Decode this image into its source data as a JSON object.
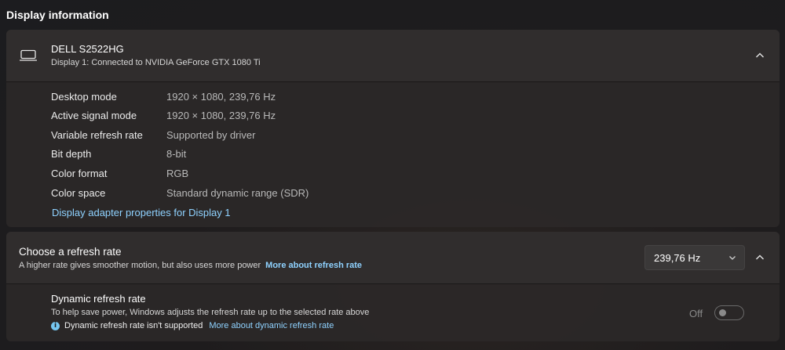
{
  "section_title": "Display information",
  "display": {
    "name": "DELL S2522HG",
    "subtitle": "Display 1: Connected to NVIDIA GeForce GTX 1080 Ti",
    "icon": "monitor-icon",
    "details": [
      {
        "label": "Desktop mode",
        "value": "1920 × 1080, 239,76 Hz"
      },
      {
        "label": "Active signal mode",
        "value": "1920 × 1080, 239,76 Hz"
      },
      {
        "label": "Variable refresh rate",
        "value": "Supported by driver"
      },
      {
        "label": "Bit depth",
        "value": "8-bit"
      },
      {
        "label": "Color format",
        "value": "RGB"
      },
      {
        "label": "Color space",
        "value": "Standard dynamic range (SDR)"
      }
    ],
    "adapter_link": "Display adapter properties for Display 1"
  },
  "refresh": {
    "title": "Choose a refresh rate",
    "subtitle": "A higher rate gives smoother motion, but also uses more power",
    "more_link": "More about refresh rate",
    "selected": "239,76 Hz",
    "dynamic": {
      "title": "Dynamic refresh rate",
      "subtitle": "To help save power, Windows adjusts the refresh rate up to the selected rate above",
      "note": "Dynamic refresh rate isn't supported",
      "note_link": "More about dynamic refresh rate",
      "toggle_label": "Off",
      "toggle_on": false
    }
  },
  "colors": {
    "link": "#8fd2ff",
    "info_icon": "#75c6f0"
  }
}
